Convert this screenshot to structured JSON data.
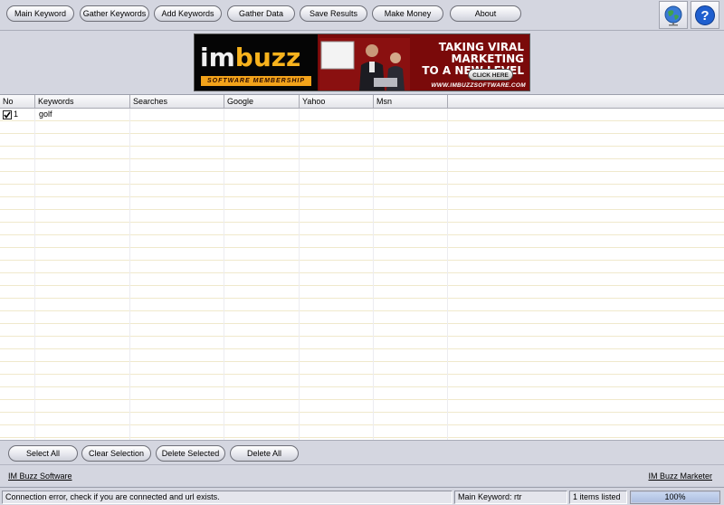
{
  "toolbar": {
    "buttons": [
      "Main Keyword",
      "Gather Keywords",
      "Add Keywords",
      "Gather Data",
      "Save Results",
      "Make Money",
      "About"
    ],
    "icons": [
      "globe-icon",
      "help-icon"
    ]
  },
  "banner": {
    "logo_im": "im",
    "logo_buzz": "buzz",
    "subtitle": "SOFTWARE MEMBERSHIP",
    "headline_1": "TAKING VIRAL MARKETING",
    "headline_2": "TO A NEW LEVEL",
    "click": "CLICK HERE",
    "url": "WWW.IMBUZZSOFTWARE.COM"
  },
  "grid": {
    "columns": [
      "No",
      "Keywords",
      "Searches",
      "Google",
      "Yahoo",
      "Msn"
    ],
    "rows": [
      {
        "checked": true,
        "no": "1",
        "keyword": "golf",
        "searches": "",
        "google": "",
        "yahoo": "",
        "msn": ""
      }
    ]
  },
  "actions": {
    "select_all": "Select All",
    "clear_selection": "Clear Selection",
    "delete_selected": "Delete Selected",
    "delete_all": "Delete All"
  },
  "links": {
    "left": "IM Buzz Software",
    "right": "IM Buzz Marketer"
  },
  "status": {
    "message": "Connection error, check if you are connected and url exists.",
    "main_keyword": "Main Keyword: rtr",
    "items": "1 items listed",
    "progress_text": "100%",
    "progress_value": 1.0
  },
  "colors": {
    "background": "#d4d6e0",
    "row_line": "#f0e9cc",
    "banner_red": "#7a0a0a",
    "banner_orange": "#f7b21d"
  }
}
